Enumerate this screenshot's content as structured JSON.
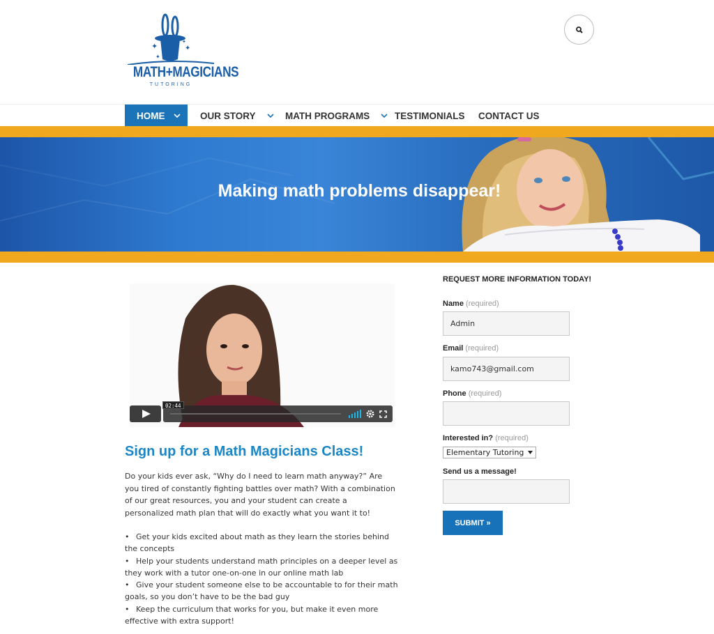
{
  "header": {
    "logo_text": "MATH+MAGICIANS",
    "logo_subtext": "TUTORING"
  },
  "nav": {
    "items": [
      {
        "label": "HOME"
      },
      {
        "label": "OUR STORY"
      },
      {
        "label": "MATH PROGRAMS"
      },
      {
        "label": "TESTIMONIALS"
      },
      {
        "label": "CONTACT US"
      }
    ]
  },
  "banner": {
    "title": "Making math problems disappear!"
  },
  "video": {
    "time": "02:44"
  },
  "article": {
    "title": "Sign up for a Math Magicians Class!",
    "paragraph": "Do your kids ever ask, “Why do I need to learn math anyway?” Are you tired of constantly fighting battles over math? With a combination of our great resources, you and your student can create a personalized math plan that will do exactly what you want it to!",
    "bullets": [
      "Get your kids excited about math as they learn the stories behind the concepts",
      "Help your students understand math principles on a deeper level as they work with a tutor one-on-one in our online math lab",
      "Give your student someone else to be accountable to for their math goals, so you don’t have to be the bad guy",
      "Keep the curriculum that works for you, but make it even more effective with extra support!"
    ]
  },
  "form": {
    "title": "REQUEST MORE INFORMATION TODAY!",
    "required_text": "(required)",
    "name_label": "Name",
    "name_value": "Admin",
    "email_label": "Email",
    "email_value": "kamo743@gmail.com",
    "phone_label": "Phone",
    "phone_value": "",
    "interest_label": "Interested in?",
    "interest_selected": "Elementary Tutoring",
    "message_label": "Send us a message!",
    "message_value": "",
    "submit_label": "SUBMIT »"
  },
  "colors": {
    "brand_blue": "#1b73b8",
    "accent_orange": "#f0a81e",
    "title_blue": "#1b86c5"
  }
}
